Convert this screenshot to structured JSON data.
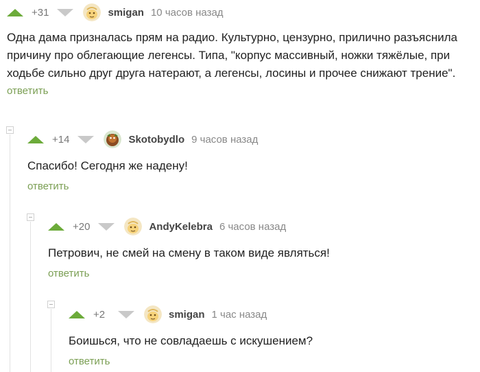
{
  "comments": [
    {
      "rating": "+31",
      "username": "smigan",
      "time": "10 часов назад",
      "avatar": "smigan-avatar-icon",
      "text": "Одна дама призналась прям на радио. Культурно, цензурно, прилично разъяснила причину про облегающие легенсы. Типа, \"корпус массивный, ножки тяжёлые, при ходьбе сильно друг друга натерают, а легенсы, лосины и прочее снижают трение\".",
      "reply_label": "ответить"
    },
    {
      "rating": "+14",
      "username": "Skotobydlo",
      "time": "9 часов назад",
      "avatar": "skotobydlo-avatar-icon",
      "text": "Спасибо! Сегодня же надену!",
      "reply_label": "ответить"
    },
    {
      "rating": "+20",
      "username": "AndyKelebra",
      "time": "6 часов назад",
      "avatar": "andykelebra-avatar-icon",
      "text": "Петрович, не смей на смену в таком виде являться!",
      "reply_label": "ответить"
    },
    {
      "rating": "+2",
      "username": "smigan",
      "time": "1 час назад",
      "avatar": "smigan-avatar-icon",
      "text": "Боишься, что не совладаешь с искушением?",
      "reply_label": "ответить"
    }
  ],
  "colors": {
    "vote_up": "#6cab3a",
    "vote_down": "#c9c9c9",
    "reply_link": "#7b9f54"
  }
}
